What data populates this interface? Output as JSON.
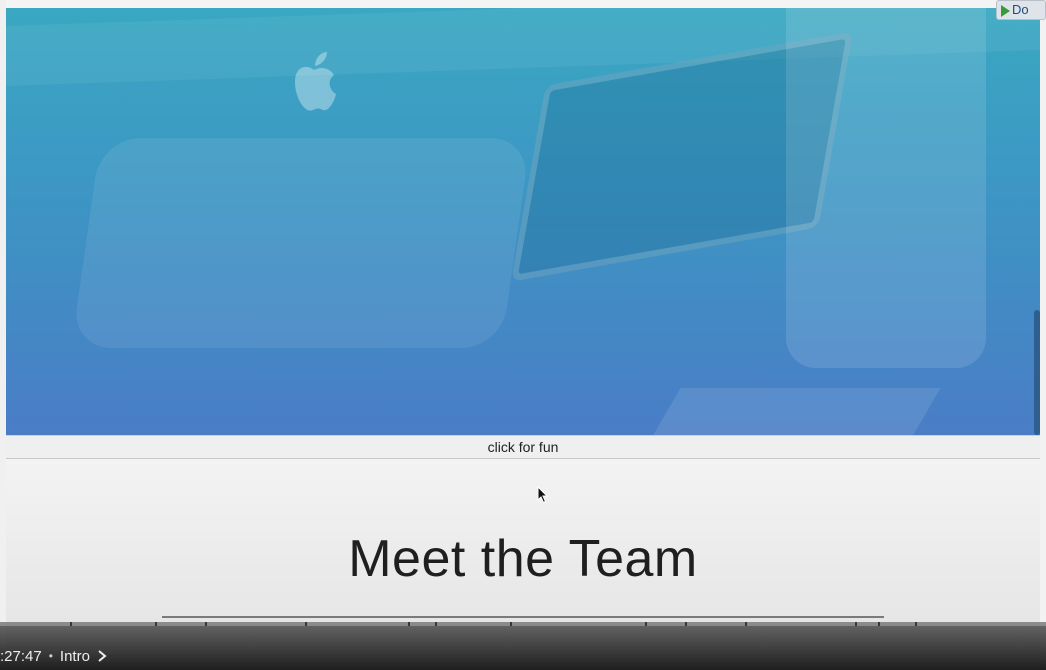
{
  "corner_badge": {
    "label": "Do"
  },
  "fun_bar": {
    "label": "click for fun"
  },
  "team_section": {
    "title": "Meet the Team"
  },
  "video_player": {
    "current_time": ":27:47",
    "separator": "•",
    "chapter_label": "Intro",
    "progress_fraction": 0.0
  },
  "colors": {
    "hero_top": "#3aa8c2",
    "hero_bottom": "#4a7dc6",
    "text_dark": "#1f1f1f"
  },
  "icons": {
    "apple": "apple-logo-icon",
    "cursor": "mouse-cursor-icon",
    "chevron": "chevron-right-icon",
    "play": "play-icon"
  }
}
